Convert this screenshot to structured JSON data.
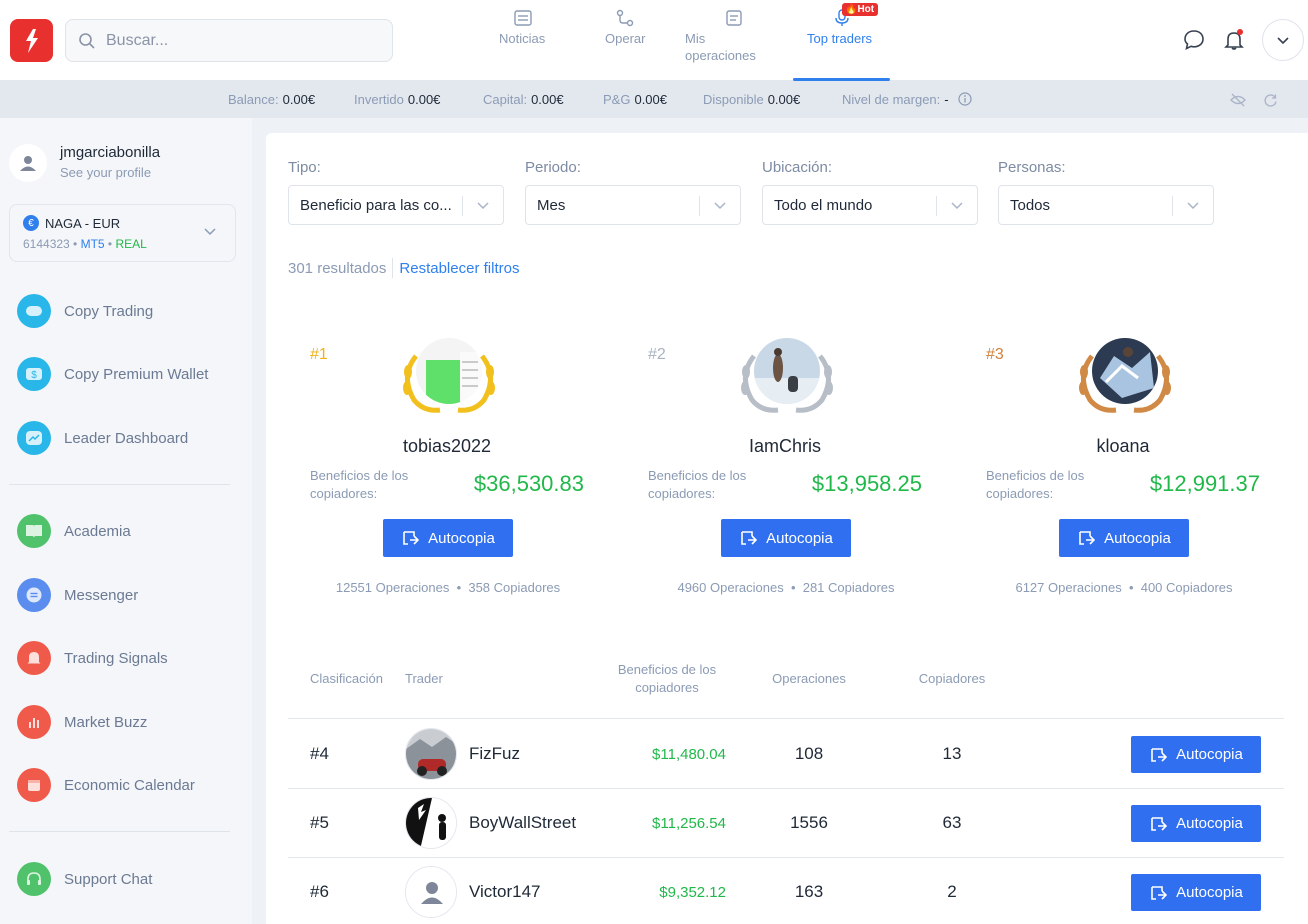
{
  "header": {
    "search_placeholder": "Buscar...",
    "nav": [
      {
        "label": "Noticias"
      },
      {
        "label": "Operar"
      },
      {
        "label_line1": "Mis",
        "label_line2": "operaciones"
      },
      {
        "label": "Top traders",
        "badge": "Hot",
        "active": true
      }
    ]
  },
  "balance_bar": [
    {
      "label": "Balance:",
      "value": "0.00€"
    },
    {
      "label": "Invertido",
      "value": "0.00€"
    },
    {
      "label": "Capital:",
      "value": "0.00€"
    },
    {
      "label": "P&G",
      "value": "0.00€"
    },
    {
      "label": "Disponible",
      "value": "0.00€"
    },
    {
      "label": "Nivel de margen:",
      "value": "-"
    }
  ],
  "sidebar": {
    "username": "jmgarciabonilla",
    "profile_link": "See your profile",
    "account": {
      "name": "NAGA - EUR",
      "number": "6144323",
      "platform": "MT5",
      "type": "REAL"
    },
    "items": [
      {
        "label": "Copy Trading",
        "icon": "copy-trading-icon",
        "color": "#29b6e8"
      },
      {
        "label": "Copy Premium Wallet",
        "icon": "wallet-icon",
        "color": "#29b6e8"
      },
      {
        "label": "Leader Dashboard",
        "icon": "dashboard-icon",
        "color": "#29b6e8"
      },
      {
        "label": "Academia",
        "icon": "book-icon",
        "color": "#4fc26b"
      },
      {
        "label": "Messenger",
        "icon": "messenger-icon",
        "color": "#5b8def"
      },
      {
        "label": "Trading Signals",
        "icon": "bell-icon",
        "color": "#f05a4a"
      },
      {
        "label": "Market Buzz",
        "icon": "chart-icon",
        "color": "#f05a4a"
      },
      {
        "label": "Economic Calendar",
        "icon": "calendar-icon",
        "color": "#f05a4a"
      },
      {
        "label": "Support Chat",
        "icon": "headset-icon",
        "color": "#4fc26b"
      }
    ]
  },
  "filters": [
    {
      "label": "Tipo:",
      "value": "Beneficio para las co..."
    },
    {
      "label": "Periodo:",
      "value": "Mes"
    },
    {
      "label": "Ubicación:",
      "value": "Todo el mundo"
    },
    {
      "label": "Personas:",
      "value": "Todos"
    }
  ],
  "results": {
    "count_text": "301 resultados",
    "reset_label": "Restablecer filtros"
  },
  "podium": [
    {
      "rank": "#1",
      "name": "tobias2022",
      "benefit_label": "Beneficios de los copiadores:",
      "benefit": "$36,530.83",
      "button": "Autocopia",
      "operations": "12551 Operaciones",
      "copiers": "358 Copiadores",
      "rank_color": "#f2b21c"
    },
    {
      "rank": "#2",
      "name": "IamChris",
      "benefit_label": "Beneficios de los copiadores:",
      "benefit": "$13,958.25",
      "button": "Autocopia",
      "operations": "4960 Operaciones",
      "copiers": "281 Copiadores",
      "rank_color": "#a9b2c0"
    },
    {
      "rank": "#3",
      "name": "kloana",
      "benefit_label": "Beneficios de los copiadores:",
      "benefit": "$12,991.37",
      "button": "Autocopia",
      "operations": "6127 Operaciones",
      "copiers": "400 Copiadores",
      "rank_color": "#d0813b"
    }
  ],
  "table": {
    "headers": {
      "rank": "Clasificación",
      "trader": "Trader",
      "benefit": "Beneficios de los copiadores",
      "operations": "Operaciones",
      "copiers": "Copiadores"
    },
    "rows": [
      {
        "rank": "#4",
        "name": "FizFuz",
        "benefit": "$11,480.04",
        "operations": "108",
        "copiers": "13",
        "button": "Autocopia"
      },
      {
        "rank": "#5",
        "name": "BoyWallStreet",
        "benefit": "$11,256.54",
        "operations": "1556",
        "copiers": "63",
        "button": "Autocopia"
      },
      {
        "rank": "#6",
        "name": "Victor147",
        "benefit": "$9,352.12",
        "operations": "163",
        "copiers": "2",
        "button": "Autocopia"
      }
    ]
  }
}
